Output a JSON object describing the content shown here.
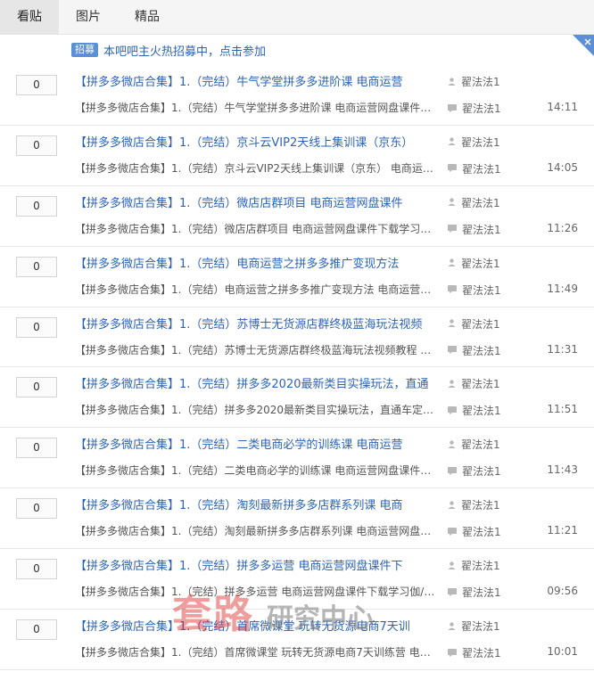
{
  "tabs": [
    {
      "label": "看贴",
      "active": true
    },
    {
      "label": "图片",
      "active": false
    },
    {
      "label": "精品",
      "active": false
    }
  ],
  "banner": {
    "badge": "招募",
    "text": "本吧吧主火热招募中，点击参加"
  },
  "threads": [
    {
      "count": "0",
      "title": "【拼多多微店合集】1.（完结）牛气学堂拼多多进阶课 电商运营",
      "author": "翟法法1",
      "abstract": "【拼多多微店合集】1.（完结）牛气学堂拼多多进阶课 电商运营网盘课件下...",
      "last_author": "翟法法1",
      "time": "14:11"
    },
    {
      "count": "0",
      "title": "【拼多多微店合集】1.（完结）京斗云VIP2天线上集训课（京东）",
      "author": "翟法法1",
      "abstract": "【拼多多微店合集】1.（完结）京斗云VIP2天线上集训课（京东） 电商运营...",
      "last_author": "翟法法1",
      "time": "14:05"
    },
    {
      "count": "0",
      "title": "【拼多多微店合集】1.（完结）微店店群项目 电商运营网盘课件",
      "author": "翟法法1",
      "abstract": "【拼多多微店合集】1.（完结）微店店群项目 电商运营网盘课件下载学习伽/...",
      "last_author": "翟法法1",
      "time": "11:26"
    },
    {
      "count": "0",
      "title": "【拼多多微店合集】1.（完结）电商运营之拼多多推广变现方法",
      "author": "翟法法1",
      "abstract": "【拼多多微店合集】1.（完结）电商运营之拼多多推广变现方法 电商运营网...",
      "last_author": "翟法法1",
      "time": "11:49"
    },
    {
      "count": "0",
      "title": "【拼多多微店合集】1.（完结）苏博士无货源店群终极蓝海玩法视频",
      "author": "翟法法1",
      "abstract": "【拼多多微店合集】1.（完结）苏博士无货源店群终极蓝海玩法视频教程 电...",
      "last_author": "翟法法1",
      "time": "11:31"
    },
    {
      "count": "0",
      "title": "【拼多多微店合集】1.（完结）拼多多2020最新类目实操玩法，直通",
      "author": "翟法法1",
      "abstract": "【拼多多微店合集】1.（完结）拼多多2020最新类目实操玩法，直通车定向...",
      "last_author": "翟法法1",
      "time": "11:51"
    },
    {
      "count": "0",
      "title": "【拼多多微店合集】1.（完结）二类电商必学的训练课 电商运营",
      "author": "翟法法1",
      "abstract": "【拼多多微店合集】1.（完结）二类电商必学的训练课 电商运营网盘课件下...",
      "last_author": "翟法法1",
      "time": "11:43"
    },
    {
      "count": "0",
      "title": "【拼多多微店合集】1.（完结）淘刻最新拼多多店群系列课 电商",
      "author": "翟法法1",
      "abstract": "【拼多多微店合集】1.（完结）淘刻最新拼多多店群系列课 电商运营网盘课...",
      "last_author": "翟法法1",
      "time": "11:21"
    },
    {
      "count": "0",
      "title": "【拼多多微店合集】1.（完结）拼多多运营 电商运营网盘课件下",
      "author": "翟法法1",
      "abstract": "【拼多多微店合集】1.（完结）拼多多运营 电商运营网盘课件下载学习伽/♥...",
      "last_author": "翟法法1",
      "time": "09:56"
    },
    {
      "count": "0",
      "title": "【拼多多微店合集】1.（完结）首席微课堂 玩转无货源电商7天训",
      "author": "翟法法1",
      "abstract": "【拼多多微店合集】1.（完结）首席微课堂 玩转无货源电商7天训练营 电商...",
      "last_author": "翟法法1",
      "time": "10:01"
    }
  ],
  "watermark": {
    "red": "套路",
    "gray": "研究中心"
  },
  "colors": {
    "link": "#2d64b3",
    "badge": "#5b8fd6",
    "tab_bg": "#f5f5f5",
    "tab_active_bg": "#e6e6e6"
  },
  "icons": {
    "author": "user-icon",
    "reply": "comment-icon",
    "corner": "close-corner-icon"
  }
}
